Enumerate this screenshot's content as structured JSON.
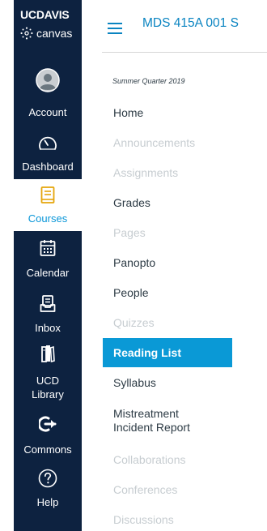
{
  "brand": {
    "uc": "UC",
    "davis": "DAVIS",
    "canvas": "canvas"
  },
  "global_nav": {
    "items": [
      {
        "label": "Account",
        "icon": "account-avatar-icon",
        "active": false
      },
      {
        "label": "Dashboard",
        "icon": "speedometer-icon",
        "active": false
      },
      {
        "label": "Courses",
        "icon": "book-icon",
        "active": true
      },
      {
        "label": "Calendar",
        "icon": "calendar-icon",
        "active": false
      },
      {
        "label": "Inbox",
        "icon": "inbox-icon",
        "active": false
      },
      {
        "label": "UCD",
        "label2": "Library",
        "icon": "library-icon",
        "active": false
      },
      {
        "label": "Commons",
        "icon": "commons-arrow-icon",
        "active": false
      },
      {
        "label": "Help",
        "icon": "help-question-icon",
        "active": false
      }
    ]
  },
  "header": {
    "menu_icon": "hamburger-menu-icon",
    "course_title": "MDS 415A 001 S"
  },
  "course_nav": {
    "term": "Summer Quarter 2019",
    "items": [
      {
        "label": "Home",
        "state": "enabled"
      },
      {
        "label": "Announcements",
        "state": "disabled"
      },
      {
        "label": "Assignments",
        "state": "disabled"
      },
      {
        "label": "Grades",
        "state": "enabled"
      },
      {
        "label": "Pages",
        "state": "disabled"
      },
      {
        "label": "Panopto",
        "state": "enabled"
      },
      {
        "label": "People",
        "state": "enabled"
      },
      {
        "label": "Quizzes",
        "state": "disabled"
      },
      {
        "label": "Reading List",
        "state": "active"
      },
      {
        "label": "Syllabus",
        "state": "enabled"
      },
      {
        "label": "Mistreatment",
        "label2": "Incident Report",
        "state": "enabled"
      },
      {
        "label": "Collaborations",
        "state": "disabled"
      },
      {
        "label": "Conferences",
        "state": "disabled"
      },
      {
        "label": "Discussions",
        "state": "disabled"
      }
    ]
  },
  "colors": {
    "nav_background": "#0d2240",
    "link_blue": "#0a84c1",
    "active_blue": "#0a99d6",
    "courses_icon_yellow": "#e5a50a",
    "disabled_text": "#c7cdd1",
    "body_text": "#2d3b45"
  }
}
